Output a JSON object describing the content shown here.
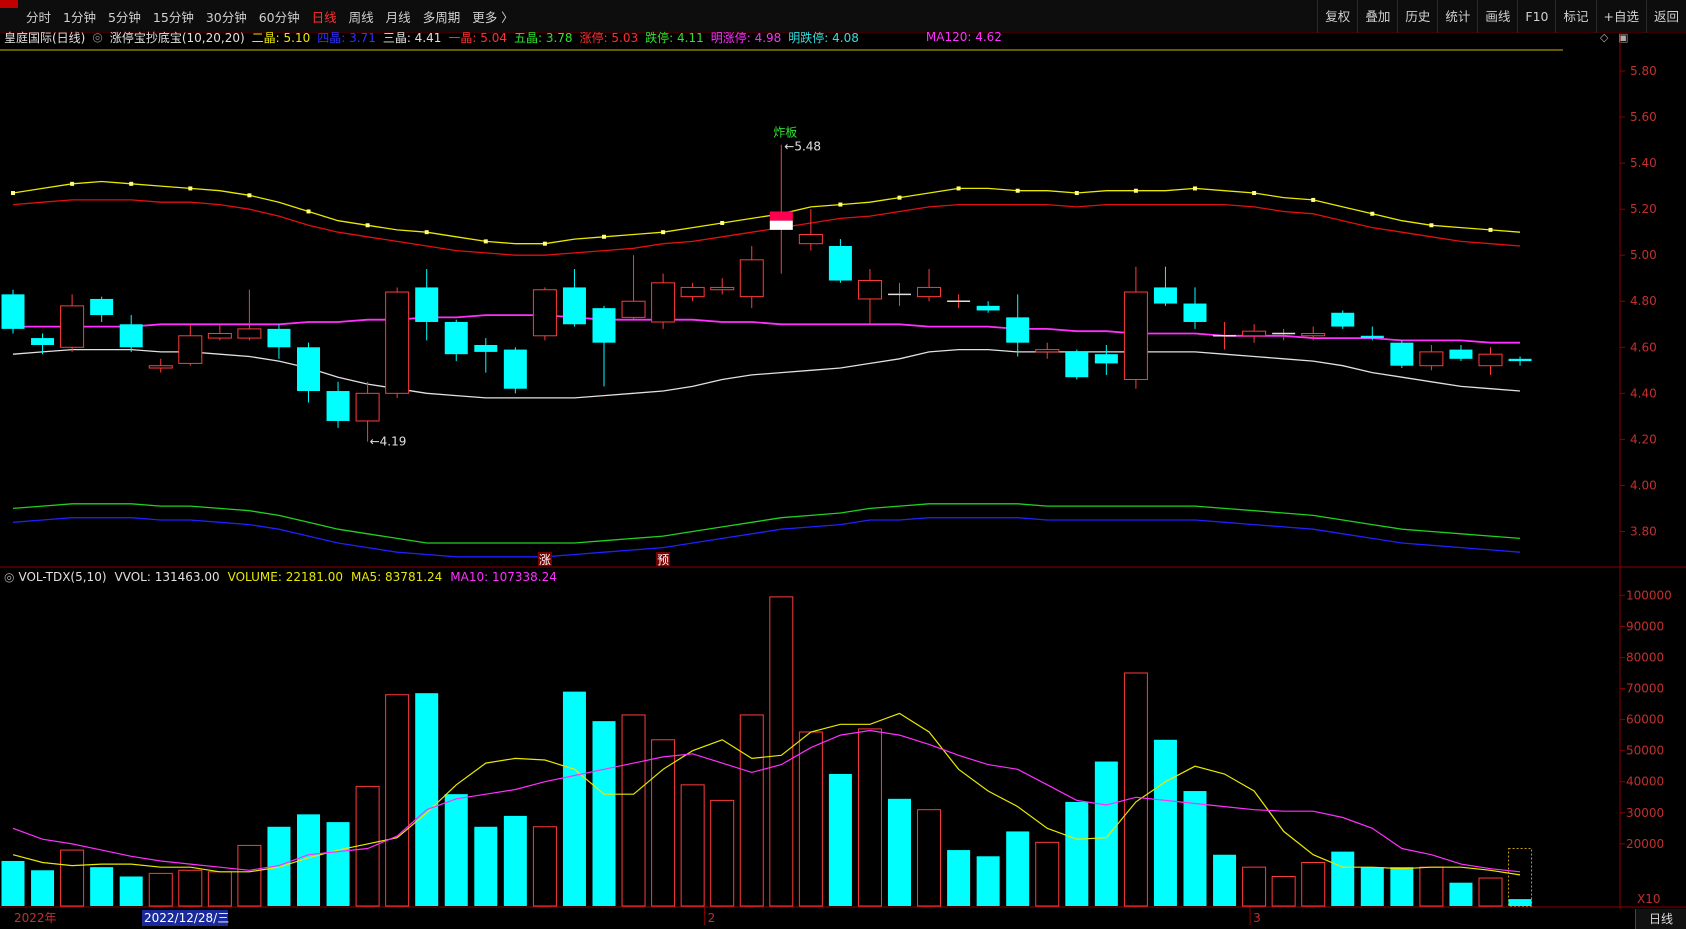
{
  "toolbar": {
    "periods": [
      "分时",
      "1分钟",
      "5分钟",
      "15分钟",
      "30分钟",
      "60分钟",
      "日线",
      "周线",
      "月线",
      "多周期",
      "更多 〉"
    ],
    "active_period": "日线",
    "right_buttons": [
      "复权",
      "叠加",
      "历史",
      "统计",
      "画线",
      "F10",
      "标记",
      "+自选",
      "返回"
    ]
  },
  "indicator_bar": {
    "stock_name": "皇庭国际(日线)",
    "indicator": "涨停宝抄底宝(10,20,20)",
    "items": [
      {
        "label": "二晶: 5.10",
        "color": "#e8e800"
      },
      {
        "label": "四晶: 3.71",
        "color": "#3030ff"
      },
      {
        "label": "三晶: 4.41",
        "color": "#e0e0e0"
      },
      {
        "label": "一晶: 5.04",
        "color": "#ff3030"
      },
      {
        "label": "五晶: 3.78",
        "color": "#30e030"
      },
      {
        "label": "涨停: 5.03",
        "color": "#ff3030"
      },
      {
        "label": "跌停: 4.11",
        "color": "#30e030"
      },
      {
        "label": "明涨停: 4.98",
        "color": "#ff30ff"
      },
      {
        "label": "明跌停: 4.08",
        "color": "#30e0e0"
      }
    ],
    "ma120": "MA120: 4.62"
  },
  "price_axis": [
    "5.80",
    "5.60",
    "5.40",
    "5.20",
    "5.00",
    "4.80",
    "4.60",
    "4.40",
    "4.20",
    "4.00",
    "3.80"
  ],
  "annotations": {
    "high_label": "5.48",
    "low_label": "4.19",
    "signal_text": "炸板",
    "marker_zhang": "涨",
    "marker_yu": "预"
  },
  "volume_info": {
    "indicator": "VOL-TDX(5,10)",
    "vvol": "VVOL: 131463.00",
    "volume": "VOLUME: 22181.00",
    "ma5": "MA5: 83781.24",
    "ma10": "MA10: 107338.24"
  },
  "volume_axis": [
    "100000",
    "90000",
    "80000",
    "70000",
    "60000",
    "50000",
    "40000",
    "30000",
    "20000"
  ],
  "volume_unit": "X10",
  "date_axis": {
    "year": "2022年",
    "cursor_date": "2022/12/28/三",
    "month2": "2",
    "month3": "3"
  },
  "status": {
    "mode": "日线"
  },
  "colors": {
    "up": "#ff3b3b",
    "down": "#00ffff",
    "ma120": "#ff30ff",
    "band_mid": "#e0e0e0",
    "band_top": "#e8e800",
    "band_red": "#e01010",
    "band_green": "#20d020",
    "band_blue": "#2020ff"
  },
  "chart_data": {
    "type": "candlestick",
    "price_range": [
      3.65,
      5.9
    ],
    "candles": [
      {
        "o": 4.68,
        "c": 4.83,
        "h": 4.85,
        "l": 4.66,
        "up": false
      },
      {
        "o": 4.64,
        "c": 4.61,
        "h": 4.66,
        "l": 4.57,
        "up": false
      },
      {
        "o": 4.6,
        "c": 4.78,
        "h": 4.83,
        "l": 4.58,
        "up": true
      },
      {
        "o": 4.81,
        "c": 4.74,
        "h": 4.82,
        "l": 4.71,
        "up": false
      },
      {
        "o": 4.7,
        "c": 4.6,
        "h": 4.74,
        "l": 4.58,
        "up": false
      },
      {
        "o": 4.51,
        "c": 4.52,
        "h": 4.55,
        "l": 4.49,
        "up": true
      },
      {
        "o": 4.53,
        "c": 4.65,
        "h": 4.7,
        "l": 4.52,
        "up": true
      },
      {
        "o": 4.64,
        "c": 4.66,
        "h": 4.7,
        "l": 4.63,
        "up": true
      },
      {
        "o": 4.64,
        "c": 4.68,
        "h": 4.85,
        "l": 4.63,
        "up": true
      },
      {
        "o": 4.68,
        "c": 4.6,
        "h": 4.7,
        "l": 4.55,
        "up": false
      },
      {
        "o": 4.6,
        "c": 4.41,
        "h": 4.62,
        "l": 4.36,
        "up": false
      },
      {
        "o": 4.41,
        "c": 4.28,
        "h": 4.45,
        "l": 4.25,
        "up": false
      },
      {
        "o": 4.28,
        "c": 4.4,
        "h": 4.45,
        "l": 4.19,
        "up": true
      },
      {
        "o": 4.4,
        "c": 4.84,
        "h": 4.86,
        "l": 4.38,
        "up": true
      },
      {
        "o": 4.86,
        "c": 4.71,
        "h": 4.94,
        "l": 4.63,
        "up": false
      },
      {
        "o": 4.71,
        "c": 4.57,
        "h": 4.72,
        "l": 4.54,
        "up": false
      },
      {
        "o": 4.61,
        "c": 4.58,
        "h": 4.64,
        "l": 4.49,
        "up": false
      },
      {
        "o": 4.59,
        "c": 4.42,
        "h": 4.6,
        "l": 4.4,
        "up": false
      },
      {
        "o": 4.65,
        "c": 4.85,
        "h": 4.86,
        "l": 4.63,
        "up": true
      },
      {
        "o": 4.86,
        "c": 4.7,
        "h": 4.94,
        "l": 4.69,
        "up": false
      },
      {
        "o": 4.77,
        "c": 4.62,
        "h": 4.78,
        "l": 4.43,
        "up": false
      },
      {
        "o": 4.73,
        "c": 4.8,
        "h": 5.0,
        "l": 4.72,
        "up": true
      },
      {
        "o": 4.71,
        "c": 4.88,
        "h": 4.92,
        "l": 4.68,
        "up": true
      },
      {
        "o": 4.82,
        "c": 4.86,
        "h": 4.88,
        "l": 4.8,
        "up": true
      },
      {
        "o": 4.85,
        "c": 4.86,
        "h": 4.9,
        "l": 4.83,
        "up": true
      },
      {
        "o": 4.82,
        "c": 4.98,
        "h": 5.04,
        "l": 4.77,
        "up": true
      },
      {
        "o": 5.19,
        "c": 5.11,
        "h": 5.48,
        "l": 4.92,
        "up": true,
        "special": true
      },
      {
        "o": 5.05,
        "c": 5.09,
        "h": 5.2,
        "l": 5.02,
        "up": true
      },
      {
        "o": 5.04,
        "c": 4.89,
        "h": 5.07,
        "l": 4.88,
        "up": false
      },
      {
        "o": 4.81,
        "c": 4.89,
        "h": 4.94,
        "l": 4.7,
        "up": true
      },
      {
        "o": 4.83,
        "c": 4.83,
        "h": 4.88,
        "l": 4.78,
        "up": true
      },
      {
        "o": 4.82,
        "c": 4.86,
        "h": 4.94,
        "l": 4.8,
        "up": true
      },
      {
        "o": 4.8,
        "c": 4.8,
        "h": 4.83,
        "l": 4.77,
        "up": true
      },
      {
        "o": 4.78,
        "c": 4.76,
        "h": 4.8,
        "l": 4.75,
        "up": false
      },
      {
        "o": 4.73,
        "c": 4.62,
        "h": 4.83,
        "l": 4.56,
        "up": false
      },
      {
        "o": 4.58,
        "c": 4.59,
        "h": 4.62,
        "l": 4.55,
        "up": true
      },
      {
        "o": 4.58,
        "c": 4.47,
        "h": 4.59,
        "l": 4.46,
        "up": false
      },
      {
        "o": 4.57,
        "c": 4.53,
        "h": 4.61,
        "l": 4.48,
        "up": false
      },
      {
        "o": 4.46,
        "c": 4.84,
        "h": 4.95,
        "l": 4.42,
        "up": true
      },
      {
        "o": 4.86,
        "c": 4.79,
        "h": 4.95,
        "l": 4.78,
        "up": false
      },
      {
        "o": 4.79,
        "c": 4.71,
        "h": 4.86,
        "l": 4.68,
        "up": false
      },
      {
        "o": 4.65,
        "c": 4.65,
        "h": 4.71,
        "l": 4.59,
        "up": true
      },
      {
        "o": 4.65,
        "c": 4.67,
        "h": 4.7,
        "l": 4.62,
        "up": true
      },
      {
        "o": 4.66,
        "c": 4.66,
        "h": 4.68,
        "l": 4.63,
        "up": true
      },
      {
        "o": 4.65,
        "c": 4.66,
        "h": 4.69,
        "l": 4.63,
        "up": true
      },
      {
        "o": 4.75,
        "c": 4.69,
        "h": 4.76,
        "l": 4.68,
        "up": false
      },
      {
        "o": 4.65,
        "c": 4.64,
        "h": 4.69,
        "l": 4.63,
        "up": false
      },
      {
        "o": 4.62,
        "c": 4.52,
        "h": 4.63,
        "l": 4.51,
        "up": false
      },
      {
        "o": 4.52,
        "c": 4.58,
        "h": 4.61,
        "l": 4.5,
        "up": true
      },
      {
        "o": 4.59,
        "c": 4.55,
        "h": 4.61,
        "l": 4.54,
        "up": false
      },
      {
        "o": 4.52,
        "c": 4.57,
        "h": 4.6,
        "l": 4.48,
        "up": true
      },
      {
        "o": 4.55,
        "c": 4.54,
        "h": 4.56,
        "l": 4.52,
        "up": false
      }
    ],
    "ma120": [
      4.69,
      4.69,
      4.69,
      4.69,
      4.69,
      4.7,
      4.7,
      4.7,
      4.7,
      4.7,
      4.71,
      4.71,
      4.72,
      4.72,
      4.73,
      4.73,
      4.74,
      4.74,
      4.74,
      4.73,
      4.72,
      4.72,
      4.72,
      4.72,
      4.71,
      4.71,
      4.7,
      4.7,
      4.7,
      4.7,
      4.7,
      4.69,
      4.69,
      4.69,
      4.68,
      4.68,
      4.67,
      4.67,
      4.66,
      4.66,
      4.66,
      4.65,
      4.65,
      4.65,
      4.64,
      4.64,
      4.64,
      4.63,
      4.63,
      4.63,
      4.62,
      4.62
    ],
    "band_top": [
      5.27,
      5.29,
      5.31,
      5.32,
      5.31,
      5.3,
      5.29,
      5.28,
      5.26,
      5.23,
      5.19,
      5.15,
      5.13,
      5.11,
      5.1,
      5.08,
      5.06,
      5.05,
      5.05,
      5.07,
      5.08,
      5.09,
      5.1,
      5.12,
      5.14,
      5.16,
      5.18,
      5.21,
      5.22,
      5.23,
      5.25,
      5.27,
      5.29,
      5.29,
      5.28,
      5.28,
      5.27,
      5.28,
      5.28,
      5.28,
      5.29,
      5.28,
      5.27,
      5.25,
      5.24,
      5.21,
      5.18,
      5.15,
      5.13,
      5.12,
      5.11,
      5.1
    ],
    "band_red": [
      5.22,
      5.23,
      5.24,
      5.24,
      5.24,
      5.23,
      5.23,
      5.22,
      5.2,
      5.17,
      5.13,
      5.1,
      5.08,
      5.06,
      5.04,
      5.02,
      5.01,
      5.0,
      5.0,
      5.01,
      5.02,
      5.03,
      5.05,
      5.06,
      5.08,
      5.1,
      5.12,
      5.14,
      5.16,
      5.17,
      5.19,
      5.21,
      5.22,
      5.22,
      5.22,
      5.22,
      5.21,
      5.22,
      5.22,
      5.22,
      5.22,
      5.22,
      5.21,
      5.19,
      5.18,
      5.15,
      5.12,
      5.1,
      5.08,
      5.06,
      5.05,
      5.04
    ],
    "band_mid": [
      4.57,
      4.58,
      4.59,
      4.59,
      4.59,
      4.58,
      4.58,
      4.57,
      4.56,
      4.54,
      4.51,
      4.47,
      4.44,
      4.42,
      4.4,
      4.39,
      4.38,
      4.38,
      4.38,
      4.38,
      4.39,
      4.4,
      4.41,
      4.43,
      4.46,
      4.48,
      4.49,
      4.5,
      4.51,
      4.53,
      4.55,
      4.58,
      4.59,
      4.59,
      4.58,
      4.58,
      4.58,
      4.58,
      4.58,
      4.58,
      4.58,
      4.57,
      4.56,
      4.55,
      4.54,
      4.52,
      4.49,
      4.47,
      4.45,
      4.43,
      4.42,
      4.41
    ],
    "band_green": [
      3.9,
      3.91,
      3.92,
      3.92,
      3.92,
      3.91,
      3.91,
      3.9,
      3.89,
      3.87,
      3.84,
      3.81,
      3.79,
      3.77,
      3.75,
      3.75,
      3.75,
      3.75,
      3.75,
      3.75,
      3.76,
      3.77,
      3.78,
      3.8,
      3.82,
      3.84,
      3.86,
      3.87,
      3.88,
      3.9,
      3.91,
      3.92,
      3.92,
      3.92,
      3.92,
      3.91,
      3.91,
      3.91,
      3.91,
      3.91,
      3.91,
      3.9,
      3.89,
      3.88,
      3.87,
      3.85,
      3.83,
      3.81,
      3.8,
      3.79,
      3.78,
      3.77
    ],
    "band_blue": [
      3.84,
      3.85,
      3.86,
      3.86,
      3.86,
      3.85,
      3.85,
      3.84,
      3.83,
      3.81,
      3.78,
      3.75,
      3.73,
      3.71,
      3.7,
      3.69,
      3.69,
      3.69,
      3.69,
      3.7,
      3.71,
      3.72,
      3.73,
      3.75,
      3.77,
      3.79,
      3.81,
      3.82,
      3.83,
      3.85,
      3.85,
      3.86,
      3.86,
      3.86,
      3.86,
      3.85,
      3.85,
      3.85,
      3.85,
      3.85,
      3.85,
      3.84,
      3.83,
      3.82,
      3.81,
      3.79,
      3.77,
      3.75,
      3.74,
      3.73,
      3.72,
      3.71
    ],
    "volume_range": [
      10000,
      103000
    ],
    "volumes": [
      14500,
      11500,
      18000,
      12500,
      9500,
      10500,
      11500,
      11000,
      19500,
      25500,
      29500,
      27000,
      38500,
      68000,
      68500,
      36000,
      25500,
      29000,
      25500,
      69000,
      59500,
      61500,
      53500,
      39000,
      34000,
      61500,
      99500,
      56000,
      42500,
      57000,
      34500,
      31000,
      18000,
      16000,
      24000,
      20500,
      33500,
      46500,
      75000,
      53500,
      37000,
      16500,
      12500,
      9500,
      14000,
      17500,
      12500,
      12500,
      12500,
      7500,
      9000,
      2218
    ],
    "volume_up": [
      false,
      false,
      true,
      false,
      false,
      true,
      true,
      true,
      true,
      false,
      false,
      false,
      true,
      true,
      false,
      false,
      false,
      false,
      true,
      false,
      false,
      true,
      true,
      true,
      true,
      true,
      true,
      true,
      false,
      true,
      false,
      true,
      false,
      false,
      false,
      true,
      false,
      false,
      true,
      false,
      false,
      false,
      true,
      true,
      true,
      false,
      false,
      false,
      true,
      false,
      true,
      false
    ],
    "vol_ma5": [
      16500,
      14000,
      13000,
      13500,
      13500,
      12500,
      12500,
      11000,
      11000,
      12500,
      15500,
      18000,
      20000,
      22000,
      30000,
      39000,
      46000,
      47500,
      47000,
      44000,
      36000,
      36000,
      44000,
      50000,
      53500,
      47500,
      48500,
      56000,
      58500,
      58500,
      62000,
      56000,
      44000,
      37000,
      32000,
      25000,
      21500,
      22000,
      33500,
      40000,
      45000,
      42500,
      37000,
      24000,
      16500,
      12500,
      12500,
      12000,
      12500,
      12500,
      11500,
      10000
    ],
    "vol_ma10": [
      25000,
      21500,
      20000,
      18000,
      16000,
      14500,
      13500,
      12500,
      11500,
      13000,
      16500,
      17500,
      18500,
      22500,
      31000,
      34500,
      36000,
      37500,
      40000,
      42000,
      44000,
      46000,
      48000,
      49000,
      46000,
      43000,
      45500,
      51000,
      55000,
      56500,
      55000,
      52000,
      48500,
      45500,
      44000,
      39000,
      34000,
      32500,
      35000,
      34000,
      33000,
      32000,
      31000,
      30500,
      30500,
      28500,
      25000,
      18500,
      16500,
      13500,
      12000,
      11000
    ]
  }
}
